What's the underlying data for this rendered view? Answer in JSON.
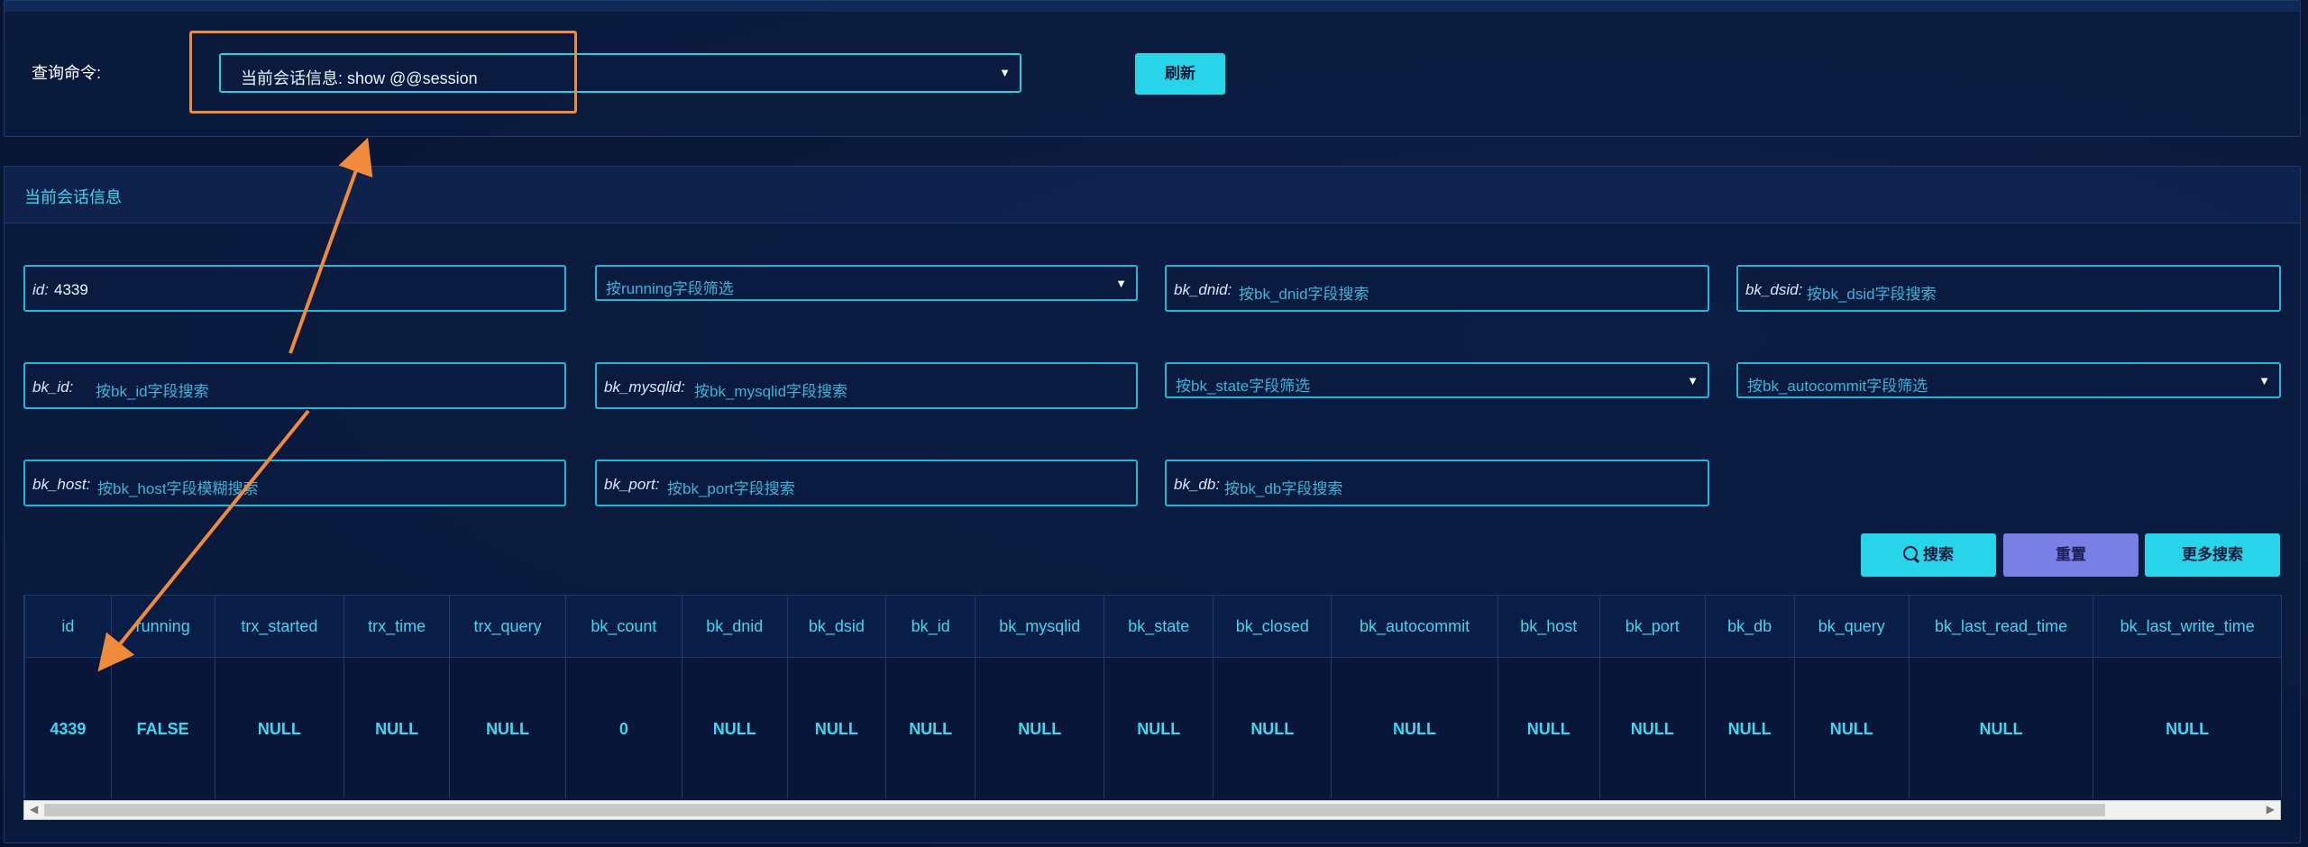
{
  "query": {
    "label": "查询命令:",
    "select_value": "当前会话信息:  show @@session",
    "refresh_label": "刷新"
  },
  "section": {
    "title": "当前会话信息"
  },
  "filters": {
    "id": {
      "label": "id:",
      "value": "4339"
    },
    "running": {
      "placeholder": "按running字段筛选"
    },
    "bk_dnid": {
      "label": "bk_dnid:",
      "placeholder": "按bk_dnid字段搜索"
    },
    "bk_dsid": {
      "label": "bk_dsid:",
      "placeholder": "按bk_dsid字段搜索"
    },
    "bk_id": {
      "label": "bk_id:",
      "placeholder": "按bk_id字段搜索"
    },
    "bk_mysqlid": {
      "label": "bk_mysqlid:",
      "placeholder": "按bk_mysqlid字段搜索"
    },
    "bk_state": {
      "placeholder": "按bk_state字段筛选"
    },
    "bk_autocommit": {
      "placeholder": "按bk_autocommit字段筛选"
    },
    "bk_host": {
      "label": "bk_host:",
      "placeholder": "按bk_host字段模糊搜索"
    },
    "bk_port": {
      "label": "bk_port:",
      "placeholder": "按bk_port字段搜索"
    },
    "bk_db": {
      "label": "bk_db:",
      "placeholder": "按bk_db字段搜索"
    }
  },
  "buttons": {
    "search": "搜索",
    "reset": "重置",
    "more": "更多搜索"
  },
  "table": {
    "columns": [
      "id",
      "running",
      "trx_started",
      "trx_time",
      "trx_query",
      "bk_count",
      "bk_dnid",
      "bk_dsid",
      "bk_id",
      "bk_mysqlid",
      "bk_state",
      "bk_closed",
      "bk_autocommit",
      "bk_host",
      "bk_port",
      "bk_db",
      "bk_query",
      "bk_last_read_time",
      "bk_last_write_time"
    ],
    "rows": [
      [
        "4339",
        "FALSE",
        "NULL",
        "NULL",
        "NULL",
        "0",
        "NULL",
        "NULL",
        "NULL",
        "NULL",
        "NULL",
        "NULL",
        "NULL",
        "NULL",
        "NULL",
        "NULL",
        "NULL",
        "NULL",
        "NULL"
      ]
    ]
  },
  "colors": {
    "accent": "#27d4ea",
    "reset": "#7a7fe6",
    "annotation": "#f08a3c",
    "border": "#1fb8d8"
  }
}
